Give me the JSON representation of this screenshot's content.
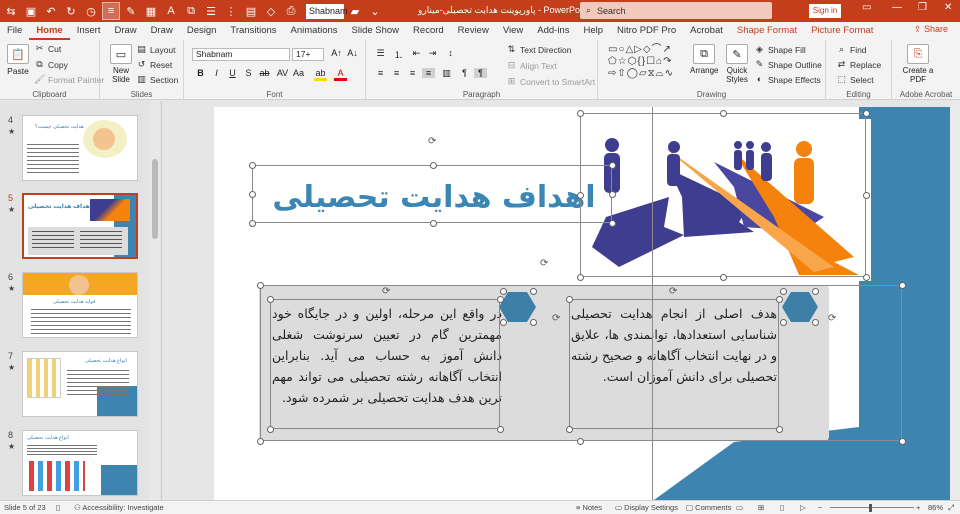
{
  "app": {
    "doc_title": "پاورپوینت هدایت تحصیلی-مینارو",
    "app_name": "PowerPoint",
    "search_placeholder": "Search",
    "signin": "Sign in",
    "quick_font": "Shabnam",
    "share": "Share"
  },
  "tabs": [
    "File",
    "Home",
    "Insert",
    "Draw",
    "Draw",
    "Design",
    "Transitions",
    "Animations",
    "Slide Show",
    "Record",
    "Review",
    "View",
    "Add-ins",
    "Help",
    "Nitro PDF Pro",
    "Acrobat",
    "Shape Format",
    "Picture Format"
  ],
  "active_tab": "Home",
  "ribbon": {
    "clipboard": {
      "label": "Clipboard",
      "paste": "Paste",
      "cut": "Cut",
      "copy": "Copy",
      "format_painter": "Format Painter"
    },
    "slides": {
      "label": "Slides",
      "new_slide": "New Slide",
      "layout": "Layout",
      "reset": "Reset",
      "section": "Section"
    },
    "font": {
      "label": "Font",
      "font_name": "Shabnam",
      "font_size": "17+"
    },
    "paragraph": {
      "label": "Paragraph",
      "text_direction": "Text Direction",
      "align_text": "Align Text",
      "convert_smartart": "Convert to SmartArt"
    },
    "drawing": {
      "label": "Drawing",
      "arrange": "Arrange",
      "quick_styles": "Quick Styles",
      "shape_fill": "Shape Fill",
      "shape_outline": "Shape Outline",
      "shape_effects": "Shape Effects"
    },
    "editing": {
      "label": "Editing",
      "find": "Find",
      "replace": "Replace",
      "select": "Select"
    },
    "adobe": {
      "label": "Adobe Acrobat",
      "create_pdf": "Create a PDF"
    }
  },
  "thumbnails": [
    {
      "num": "4",
      "star": "★",
      "title": "هدایت تحصیلی چیست؟"
    },
    {
      "num": "5",
      "star": "★",
      "title": "اهداف هدایت تحصیلی",
      "selected": true
    },
    {
      "num": "6",
      "star": "★",
      "title": "فواید هدایت تحصیلی"
    },
    {
      "num": "7",
      "star": "★",
      "title": "انواع هدایت تحصیلی"
    },
    {
      "num": "8",
      "star": "★",
      "title": "انواع هدایت تحصیلی"
    }
  ],
  "slide": {
    "title": "اهداف هدایت تحصیلی",
    "left_text": "در واقع این مرحله، اولین و در جایگاه خود مهمترین گام در تعیین سرنوشت شغلی دانش آموز به حساب می آید. بنابراین انتخاب آگاهانه رشته تحصیلی می تواند مهم ترین هدف هدایت تحصیلی بر شمرده شود.",
    "right_text": "هدف اصلی از انجام هدایت تحصیلی شناسایی استعدادها، توانمندی ها، علایق و در نهایت انتخاب آگاهانه و صحیح رشته تحصیلی برای دانش آموزان است.",
    "colors": {
      "blue": "#3d84b0",
      "title_blue": "#3b86b5",
      "hex": "#3e7fa8",
      "panel": "#dcdcdc",
      "orange": "#f5820d",
      "figure_purple": "#3f3d8f"
    }
  },
  "status": {
    "slide_info": "Slide 5 of 23",
    "accessibility": "Accessibility: Investigate",
    "notes": "Notes",
    "display_settings": "Display Settings",
    "comments": "Comments",
    "zoom": "86%"
  }
}
